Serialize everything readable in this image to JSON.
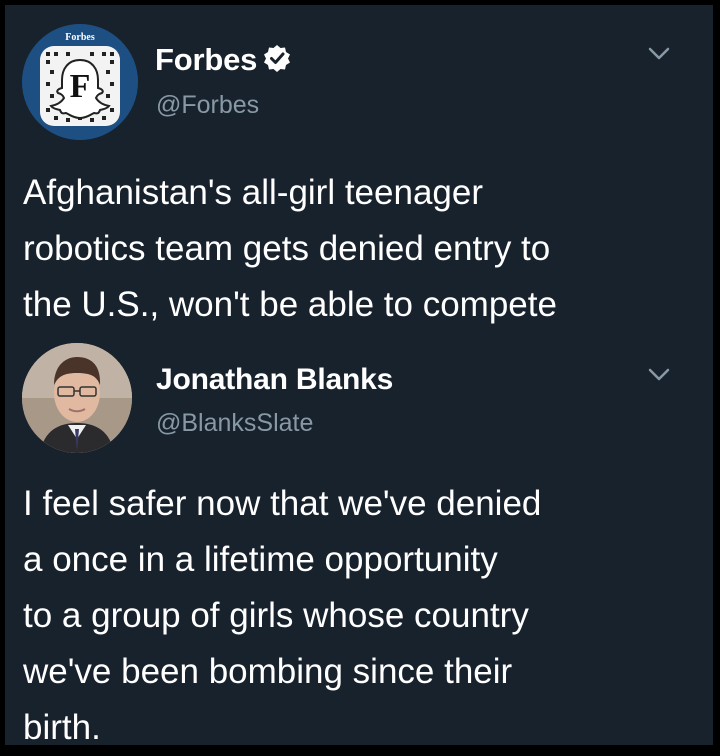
{
  "tweets": [
    {
      "name": "Forbes",
      "handle": "@Forbes",
      "verified": true,
      "avatar_wordmark": "Forbes",
      "avatar_letter": "F",
      "text_lines": [
        "Afghanistan's all-girl teenager",
        "robotics team gets denied entry to",
        "the U.S., won't be able to compete"
      ]
    },
    {
      "name": "Jonathan Blanks",
      "handle": "@BlanksSlate",
      "verified": false,
      "text_lines": [
        "I feel safer now that we've denied",
        "a once in a lifetime opportunity",
        "to a group of girls whose country",
        "we've been bombing since their",
        "birth."
      ]
    }
  ],
  "colors": {
    "background": "#18222d",
    "frame": "#000000",
    "text": "#ffffff",
    "secondary": "#8899a6",
    "verified": "#ffffff"
  },
  "icons": {
    "menu": "chevron-down-icon",
    "verified": "verified-badge-icon"
  }
}
